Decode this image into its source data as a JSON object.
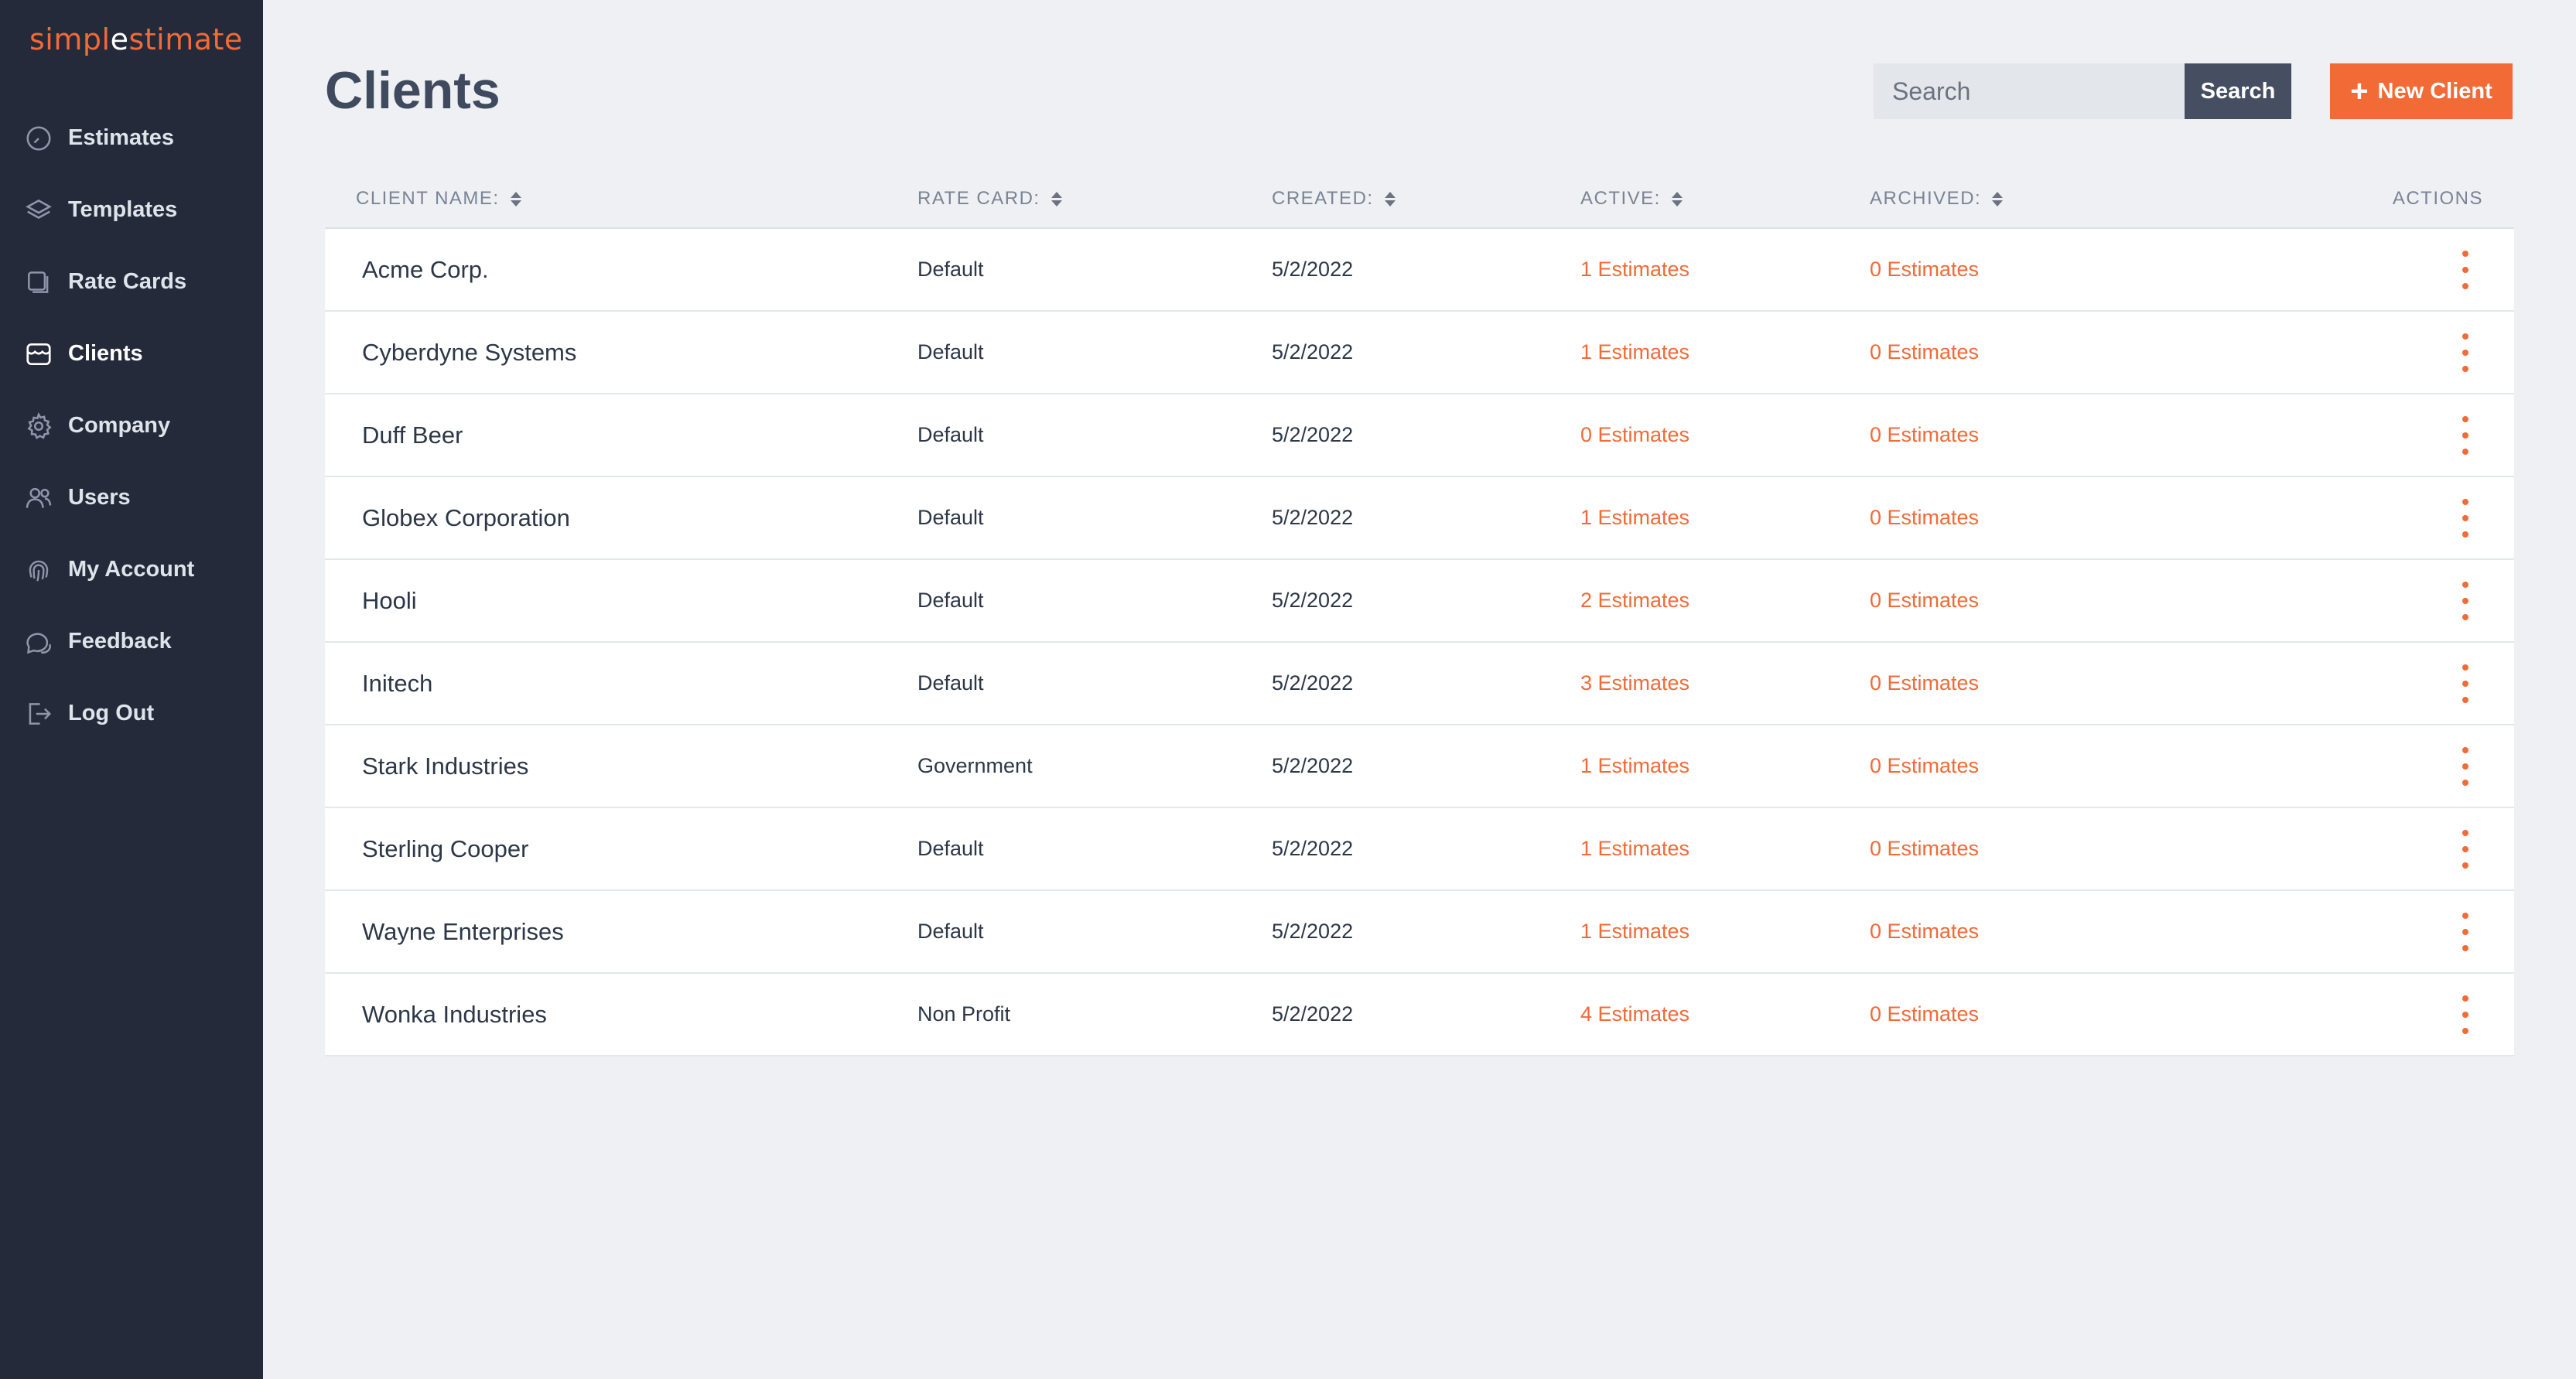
{
  "brand": {
    "part1": "simpl",
    "part2": "e",
    "part3": "stimate"
  },
  "sidebar": {
    "items": [
      {
        "label": "Estimates",
        "icon": "clock-icon"
      },
      {
        "label": "Templates",
        "icon": "layers-icon"
      },
      {
        "label": "Rate Cards",
        "icon": "cards-icon"
      },
      {
        "label": "Clients",
        "icon": "store-icon",
        "active": true
      },
      {
        "label": "Company",
        "icon": "gear-icon"
      },
      {
        "label": "Users",
        "icon": "users-icon"
      },
      {
        "label": "My Account",
        "icon": "fingerprint-icon"
      },
      {
        "label": "Feedback",
        "icon": "chat-icon"
      },
      {
        "label": "Log Out",
        "icon": "logout-icon"
      }
    ]
  },
  "page": {
    "title": "Clients",
    "search_placeholder": "Search",
    "search_button": "Search",
    "new_button": "New Client"
  },
  "table": {
    "headers": {
      "name": "CLIENT NAME:",
      "rate": "RATE CARD:",
      "created": "CREATED:",
      "active": "ACTIVE:",
      "archived": "ARCHIVED:",
      "actions": "ACTIONS"
    },
    "rows": [
      {
        "name": "Acme Corp.",
        "rate": "Default",
        "created": "5/2/2022",
        "active": "1 Estimates",
        "archived": "0 Estimates"
      },
      {
        "name": "Cyberdyne Systems",
        "rate": "Default",
        "created": "5/2/2022",
        "active": "1 Estimates",
        "archived": "0 Estimates"
      },
      {
        "name": "Duff Beer",
        "rate": "Default",
        "created": "5/2/2022",
        "active": "0 Estimates",
        "archived": "0 Estimates"
      },
      {
        "name": "Globex Corporation",
        "rate": "Default",
        "created": "5/2/2022",
        "active": "1 Estimates",
        "archived": "0 Estimates"
      },
      {
        "name": "Hooli",
        "rate": "Default",
        "created": "5/2/2022",
        "active": "2 Estimates",
        "archived": "0 Estimates"
      },
      {
        "name": "Initech",
        "rate": "Default",
        "created": "5/2/2022",
        "active": "3 Estimates",
        "archived": "0 Estimates"
      },
      {
        "name": "Stark Industries",
        "rate": "Government",
        "created": "5/2/2022",
        "active": "1 Estimates",
        "archived": "0 Estimates"
      },
      {
        "name": "Sterling Cooper",
        "rate": "Default",
        "created": "5/2/2022",
        "active": "1 Estimates",
        "archived": "0 Estimates"
      },
      {
        "name": "Wayne Enterprises",
        "rate": "Default",
        "created": "5/2/2022",
        "active": "1 Estimates",
        "archived": "0 Estimates"
      },
      {
        "name": "Wonka Industries",
        "rate": "Non Profit",
        "created": "5/2/2022",
        "active": "4 Estimates",
        "archived": "0 Estimates"
      }
    ]
  },
  "colors": {
    "accent": "#f26a36",
    "sidebar": "#252a3b",
    "background": "#eef0f4"
  }
}
